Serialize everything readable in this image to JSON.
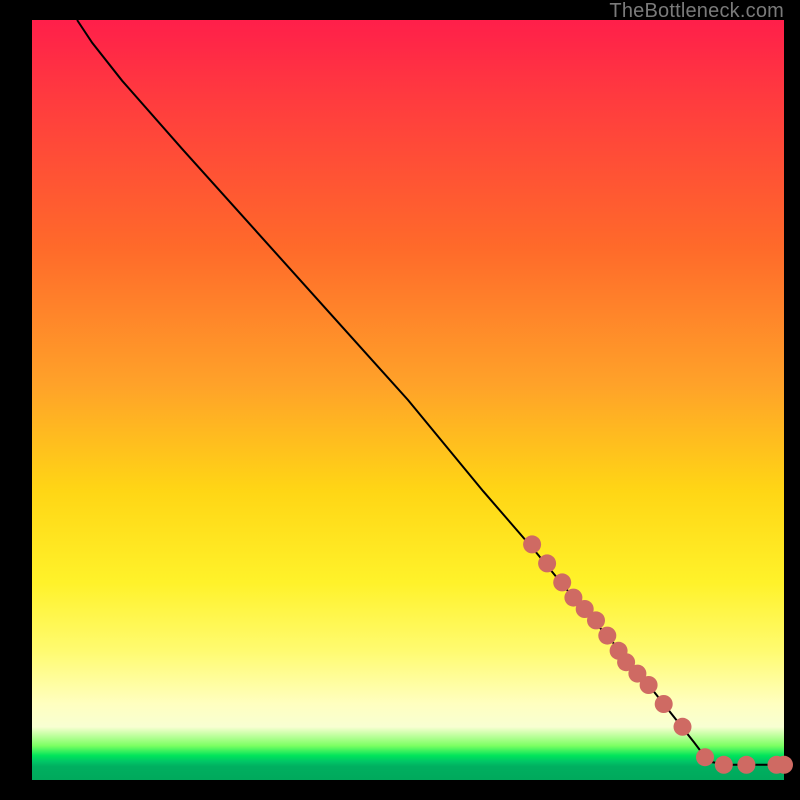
{
  "watermark": "TheBottleneck.com",
  "colors": {
    "dot": "#cf6a63",
    "curve": "#000000",
    "gradient_top": "#ff1f4a",
    "gradient_bottom": "#00a95c"
  },
  "chart_data": {
    "type": "line",
    "title": "",
    "xlabel": "",
    "ylabel": "",
    "xlim": [
      0,
      100
    ],
    "ylim": [
      0,
      100
    ],
    "grid": false,
    "legend": null,
    "note": "Axes are unlabeled in the source image; values are estimated on a 0–100 scale from pixel positions. The curve starts near (6,100), descends roughly linearly to about (90,2), then flattens along the bottom to (100,2). Salmon dots mark the lower-right segment of the curve.",
    "series": [
      {
        "name": "curve",
        "kind": "line",
        "x": [
          6,
          8,
          12,
          20,
          30,
          40,
          50,
          60,
          67,
          72,
          76,
          80,
          84,
          88,
          90,
          93,
          96,
          100
        ],
        "y": [
          100,
          97,
          92,
          83,
          72,
          61,
          50,
          38,
          30,
          24,
          19.5,
          15,
          10,
          5,
          2.4,
          2,
          2,
          2
        ]
      },
      {
        "name": "dots",
        "kind": "scatter",
        "x": [
          66.5,
          68.5,
          70.5,
          72.0,
          73.5,
          75.0,
          76.5,
          78.0,
          79.0,
          80.5,
          82.0,
          84.0,
          86.5,
          89.5,
          92.0,
          95.0,
          99.0,
          100.0
        ],
        "y": [
          31.0,
          28.5,
          26.0,
          24.0,
          22.5,
          21.0,
          19.0,
          17.0,
          15.5,
          14.0,
          12.5,
          10.0,
          7.0,
          3.0,
          2.0,
          2.0,
          2.0,
          2.0
        ]
      }
    ]
  }
}
